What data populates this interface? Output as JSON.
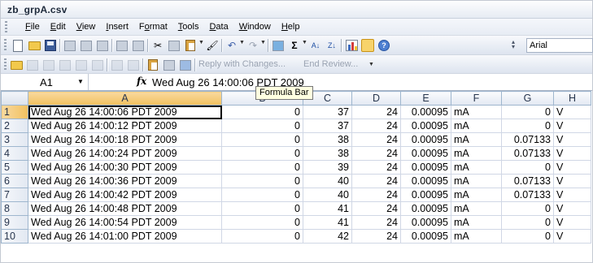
{
  "window": {
    "title": "zb_grpA.csv"
  },
  "menubar": {
    "items": [
      {
        "pre": "",
        "key": "F",
        "post": "ile"
      },
      {
        "pre": "",
        "key": "E",
        "post": "dit"
      },
      {
        "pre": "",
        "key": "V",
        "post": "iew"
      },
      {
        "pre": "",
        "key": "I",
        "post": "nsert"
      },
      {
        "pre": "F",
        "key": "o",
        "post": "rmat"
      },
      {
        "pre": "",
        "key": "T",
        "post": "ools"
      },
      {
        "pre": "",
        "key": "D",
        "post": "ata"
      },
      {
        "pre": "",
        "key": "W",
        "post": "indow"
      },
      {
        "pre": "",
        "key": "H",
        "post": "elp"
      }
    ]
  },
  "toolbar": {
    "font_name": "Arial",
    "sigma": "Σ",
    "sort_asc": "A↓",
    "sort_desc": "Z↓",
    "help": "?"
  },
  "reviewing": {
    "reply_label": "Reply with Changes...",
    "end_review_label": "End Review..."
  },
  "formula_bar": {
    "name_box": "A1",
    "fx": "fx",
    "value": "Wed Aug 26 14:00:06 PDT 2009",
    "tooltip": "Formula Bar"
  },
  "sheet": {
    "columns": [
      "A",
      "B",
      "C",
      "D",
      "E",
      "F",
      "G",
      "H"
    ],
    "active_column": "A",
    "rows": [
      {
        "n": "1",
        "A": "Wed Aug 26 14:00:06 PDT 2009",
        "B": "0",
        "C": "37",
        "D": "24",
        "E": "0.00095",
        "F": "mA",
        "G": "0",
        "H": "V"
      },
      {
        "n": "2",
        "A": "Wed Aug 26 14:00:12 PDT 2009",
        "B": "0",
        "C": "37",
        "D": "24",
        "E": "0.00095",
        "F": "mA",
        "G": "0",
        "H": "V"
      },
      {
        "n": "3",
        "A": "Wed Aug 26 14:00:18 PDT 2009",
        "B": "0",
        "C": "38",
        "D": "24",
        "E": "0.00095",
        "F": "mA",
        "G": "0.07133",
        "H": "V"
      },
      {
        "n": "4",
        "A": "Wed Aug 26 14:00:24 PDT 2009",
        "B": "0",
        "C": "38",
        "D": "24",
        "E": "0.00095",
        "F": "mA",
        "G": "0.07133",
        "H": "V"
      },
      {
        "n": "5",
        "A": "Wed Aug 26 14:00:30 PDT 2009",
        "B": "0",
        "C": "39",
        "D": "24",
        "E": "0.00095",
        "F": "mA",
        "G": "0",
        "H": "V"
      },
      {
        "n": "6",
        "A": "Wed Aug 26 14:00:36 PDT 2009",
        "B": "0",
        "C": "40",
        "D": "24",
        "E": "0.00095",
        "F": "mA",
        "G": "0.07133",
        "H": "V"
      },
      {
        "n": "7",
        "A": "Wed Aug 26 14:00:42 PDT 2009",
        "B": "0",
        "C": "40",
        "D": "24",
        "E": "0.00095",
        "F": "mA",
        "G": "0.07133",
        "H": "V"
      },
      {
        "n": "8",
        "A": "Wed Aug 26 14:00:48 PDT 2009",
        "B": "0",
        "C": "41",
        "D": "24",
        "E": "0.00095",
        "F": "mA",
        "G": "0",
        "H": "V"
      },
      {
        "n": "9",
        "A": "Wed Aug 26 14:00:54 PDT 2009",
        "B": "0",
        "C": "41",
        "D": "24",
        "E": "0.00095",
        "F": "mA",
        "G": "0",
        "H": "V"
      },
      {
        "n": "10",
        "A": "Wed Aug 26 14:01:00 PDT 2009",
        "B": "0",
        "C": "42",
        "D": "24",
        "E": "0.00095",
        "F": "mA",
        "G": "0",
        "H": "V"
      }
    ]
  },
  "colors": {
    "selection_border": "#000000",
    "active_header": "#f5cc7a",
    "gridline": "#d0d7e5"
  }
}
